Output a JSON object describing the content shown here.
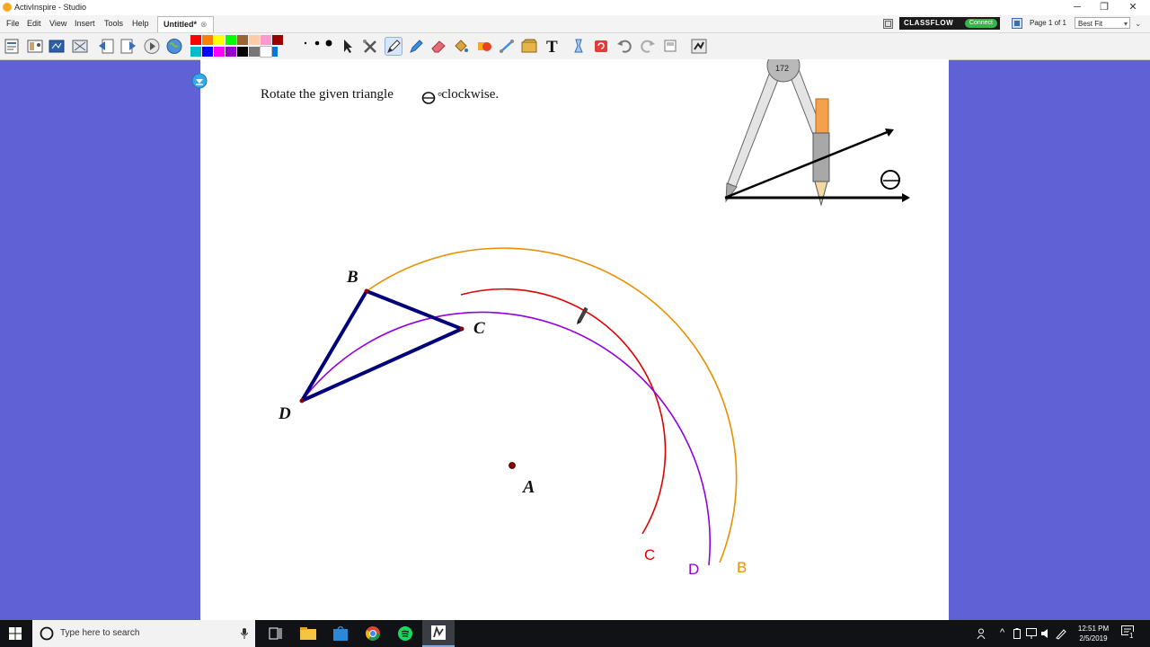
{
  "window": {
    "title": "ActivInspire - Studio",
    "controls": [
      "─",
      "❐",
      "✕"
    ]
  },
  "menu": {
    "items": [
      "File",
      "Edit",
      "View",
      "Insert",
      "Tools",
      "Help"
    ],
    "document_tab": "Untitled*"
  },
  "header_right": {
    "classflow_label": "CLASSFLOW",
    "connect_label": "Connect",
    "page_info": "Page 1 of 1",
    "zoom_value": "Best Fit"
  },
  "toolbar": {
    "palette": [
      "#ff0000",
      "#ff8000",
      "#ffff00",
      "#00ff00",
      "#996633",
      "#ffccaa",
      "#ff99cc",
      "#990000",
      "#00bbcc",
      "#0000ff",
      "#ff00ff",
      "#9900cc",
      "#000000",
      "#777777",
      "#ffffff",
      "#0077dd"
    ],
    "tools": [
      "select-tool-icon",
      "tools-icon",
      "pen-icon",
      "highlighter-icon",
      "eraser-icon",
      "fill-icon",
      "shape-icon",
      "connector-icon",
      "clipart-icon",
      "text-icon",
      "magic-ink-icon",
      "reset-page-icon",
      "undo-icon",
      "redo-icon",
      "page-icon",
      "dual-user-icon"
    ]
  },
  "canvas": {
    "instruction_before": "Rotate the given triangle",
    "instruction_degree": "°",
    "instruction_after": "clockwise.",
    "theta_symbol": "ϴ",
    "compass_reading": "172",
    "point_labels": {
      "B": "B",
      "C": "C",
      "D": "D",
      "A": "A"
    },
    "arc_labels": {
      "c": "C",
      "d": "D",
      "b": "B"
    },
    "colors": {
      "triangle": "#00007a",
      "arc_c": "#e00000",
      "arc_d": "#9400e0",
      "arc_b": "#e89000",
      "point": "#8b0000"
    }
  },
  "taskbar": {
    "search_placeholder": "Type here to search",
    "time": "12:51 PM",
    "date": "2/5/2019",
    "notification_count": "1"
  }
}
